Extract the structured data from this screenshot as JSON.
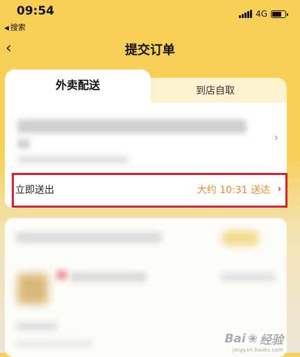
{
  "status_bar": {
    "time": "09:54",
    "back_app": "搜索",
    "network": "4G"
  },
  "nav": {
    "title": "提交订单"
  },
  "tabs": [
    {
      "label": "外卖配送",
      "active": true
    },
    {
      "label": "到店自取",
      "active": false
    }
  ],
  "dispatch": {
    "label": "立即送出",
    "eta": "大约 10:31 送达"
  },
  "colors": {
    "header_yellow": "#f7d055",
    "highlight_red": "#e41d2c",
    "eta_orange": "#e8892b"
  },
  "watermark": {
    "brand_text": "Bai",
    "brand_text2": "经验",
    "sub": "jingyan.baidu.com"
  }
}
